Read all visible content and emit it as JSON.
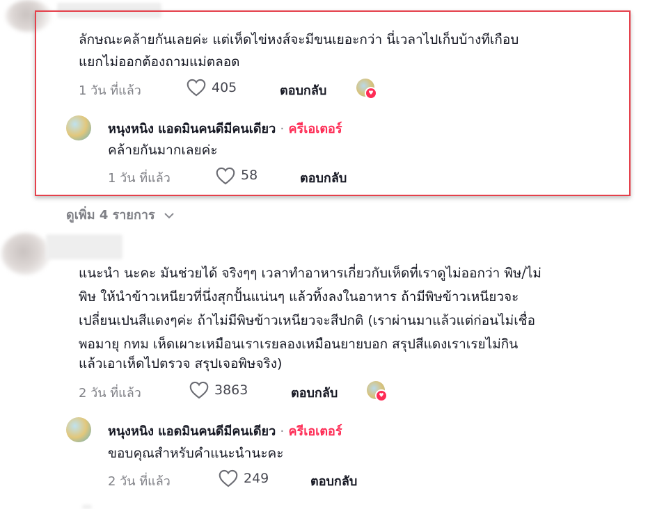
{
  "comments": [
    {
      "lines": [
        "ลักษณะคล้ายกันเลยค่ะ แต่เห็ดไข่หงส์จะมีขนเยอะกว่า นี่เวลาไปเก็บบ้างทีเกือบ",
        "แยกไม่ออกต้องถามแม่ตลอด"
      ],
      "time": "1 วัน ที่แล้ว",
      "likes": "405",
      "reply_label": "ตอบกลับ",
      "reply": {
        "name": "หนุงหนิง แอดมินคนดีมีคนเดียว",
        "separator": "·",
        "creator_label": "ครีเอเตอร์",
        "text": "คล้ายกันมากเลยค่ะ",
        "time": "1 วัน ที่แล้ว",
        "likes": "58",
        "reply_label": "ตอบกลับ"
      }
    },
    {
      "lines": [
        "แนะนำ นะคะ มันช่วยได้ จริงๆๆ เวลาทำอาหารเกี่ยวกับเห็ดที่เราดูไม่ออกว่า พิษ/ไม่",
        "พิษ ให้นำข้าวเหนียวที่นึ่งสุกปั้นแน่นๆ แล้วทิ้งลงในอาหาร ถ้ามีพิษข้าวเหนียวจะ",
        "เปลี่ยนเปนสีแดงๆค่ะ ถ้าไม่มีพิษข้าวเหนียวจะสีปกติ (เราผ่านมาแล้วแต่ก่อนไม่เชื่อ",
        "พอมายุ กทม เห็ดเผาะเหมือนเราเรยลองเหมือนยายบอก สรุปสีแดงเราเรยไม่กิน",
        "แล้วเอาเห็ดไปตรวจ สรุปเจอพิษจริง)"
      ],
      "time": "2 วัน ที่แล้ว",
      "likes": "3863",
      "reply_label": "ตอบกลับ",
      "reply": {
        "name": "หนุงหนิง แอดมินคนดีมีคนเดียว",
        "separator": "·",
        "creator_label": "ครีเอเตอร์",
        "text": "ขอบคุณสำหรับคำแนะนำนะคะ",
        "time": "2 วัน ที่แล้ว",
        "likes": "249",
        "reply_label": "ตอบกลับ"
      }
    }
  ],
  "view_more": "ดูเพิ่ม 4 รายการ",
  "colors": {
    "highlight_border": "#e5404b",
    "creator_accent": "#fe2c55",
    "text_primary": "#161823",
    "text_secondary": "#8a8b91"
  },
  "icons": {
    "like": "heart-outline-icon",
    "expand": "chevron-down-icon",
    "creator_liked": "creator-heart-badge-icon"
  }
}
